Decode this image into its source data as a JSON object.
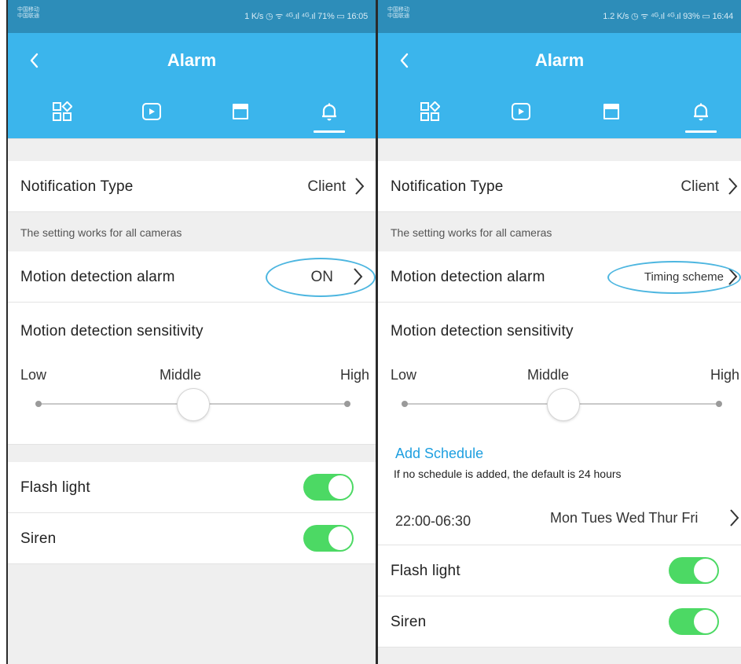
{
  "left": {
    "status": {
      "carrier": "中国移动\n中国联通",
      "right": "1 K/s ◷ ᯤ ⁴ᴳ.ıl ⁴ᴳ.ıl 71% ▭ 16:05"
    },
    "title": "Alarm",
    "tabs": [
      "devices-tab",
      "playback-tab",
      "sd-card-tab",
      "alarm-tab"
    ],
    "notification_type": {
      "label": "Notification Type",
      "value": "Client"
    },
    "note": "The setting works for all cameras",
    "motion_alarm": {
      "label": "Motion detection alarm",
      "value": "ON"
    },
    "sensitivity": {
      "title": "Motion detection sensitivity",
      "low": "Low",
      "middle": "Middle",
      "high": "High",
      "level": "Middle"
    },
    "flash_light": {
      "label": "Flash light",
      "on": true
    },
    "siren": {
      "label": "Siren",
      "on": true
    }
  },
  "right": {
    "status": {
      "carrier": "中国移动\n中国联通",
      "right": "1.2 K/s ◷ ᯤ ⁴ᴳ.ıl ⁴ᴳ.ıl 93% ▭ 16:44"
    },
    "title": "Alarm",
    "notification_type": {
      "label": "Notification Type",
      "value": "Client"
    },
    "note": "The setting works for all cameras",
    "motion_alarm": {
      "label": "Motion detection alarm",
      "value": "Timing scheme"
    },
    "sensitivity": {
      "title": "Motion detection sensitivity",
      "low": "Low",
      "middle": "Middle",
      "high": "High",
      "level": "Middle"
    },
    "schedule": {
      "add_label": "Add Schedule",
      "note": "If no schedule is added, the default is 24 hours",
      "time": "22:00-06:30",
      "days": "Mon Tues Wed Thur Fri"
    },
    "flash_light": {
      "label": "Flash light",
      "on": true
    },
    "siren": {
      "label": "Siren",
      "on": true
    }
  },
  "colors": {
    "appbar": "#3bb5ec",
    "statusbar": "#2d8db9",
    "toggle_on": "#4cd964",
    "link": "#1e9fe0",
    "annotation": "#4db6e0"
  }
}
